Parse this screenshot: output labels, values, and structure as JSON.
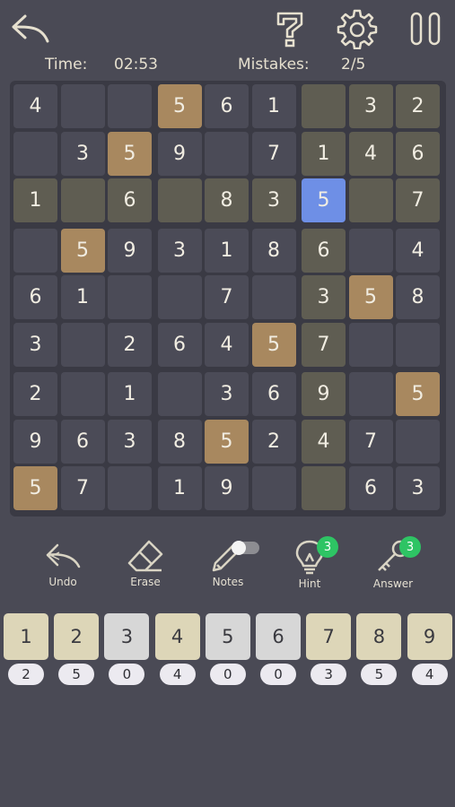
{
  "header": {
    "time_label": "Time:",
    "time_value": "02:53",
    "mistakes_label": "Mistakes:",
    "mistakes_value": "2/5",
    "icons": [
      "back-arrow-icon",
      "help-icon",
      "gear-icon",
      "pause-icon"
    ]
  },
  "board": {
    "selected": [
      2,
      6
    ],
    "grid": [
      [
        "4",
        "",
        "",
        "5",
        "6",
        "1",
        "",
        "3",
        "2"
      ],
      [
        "",
        "3",
        "5",
        "9",
        "",
        "7",
        "1",
        "4",
        "6"
      ],
      [
        "1",
        "",
        "6",
        "",
        "8",
        "3",
        "5",
        "",
        "7"
      ],
      [
        "",
        "5",
        "9",
        "3",
        "1",
        "8",
        "6",
        "",
        "4"
      ],
      [
        "6",
        "1",
        "",
        "",
        "7",
        "",
        "3",
        "5",
        "8"
      ],
      [
        "3",
        "",
        "2",
        "6",
        "4",
        "5",
        "7",
        "",
        ""
      ],
      [
        "2",
        "",
        "1",
        "",
        "3",
        "6",
        "9",
        "",
        "5"
      ],
      [
        "9",
        "6",
        "3",
        "8",
        "5",
        "2",
        "4",
        "7",
        ""
      ],
      [
        "5",
        "7",
        "",
        "1",
        "9",
        "",
        "",
        "6",
        "3"
      ]
    ]
  },
  "tools": {
    "undo": "Undo",
    "erase": "Erase",
    "notes": "Notes",
    "hint": "Hint",
    "answer": "Answer",
    "hint_count": "3",
    "answer_count": "3",
    "notes_on": false
  },
  "keypad": {
    "keys": [
      "1",
      "2",
      "3",
      "4",
      "5",
      "6",
      "7",
      "8",
      "9"
    ],
    "counts": [
      "2",
      "5",
      "0",
      "4",
      "0",
      "0",
      "3",
      "5",
      "4"
    ]
  },
  "colors": {
    "background": "#4a4a55",
    "cell": "#4b4b57",
    "highlight": "#5f5d52",
    "same_number": "#a8885f",
    "selected": "#6e8fe6",
    "badge": "#2ec464"
  }
}
